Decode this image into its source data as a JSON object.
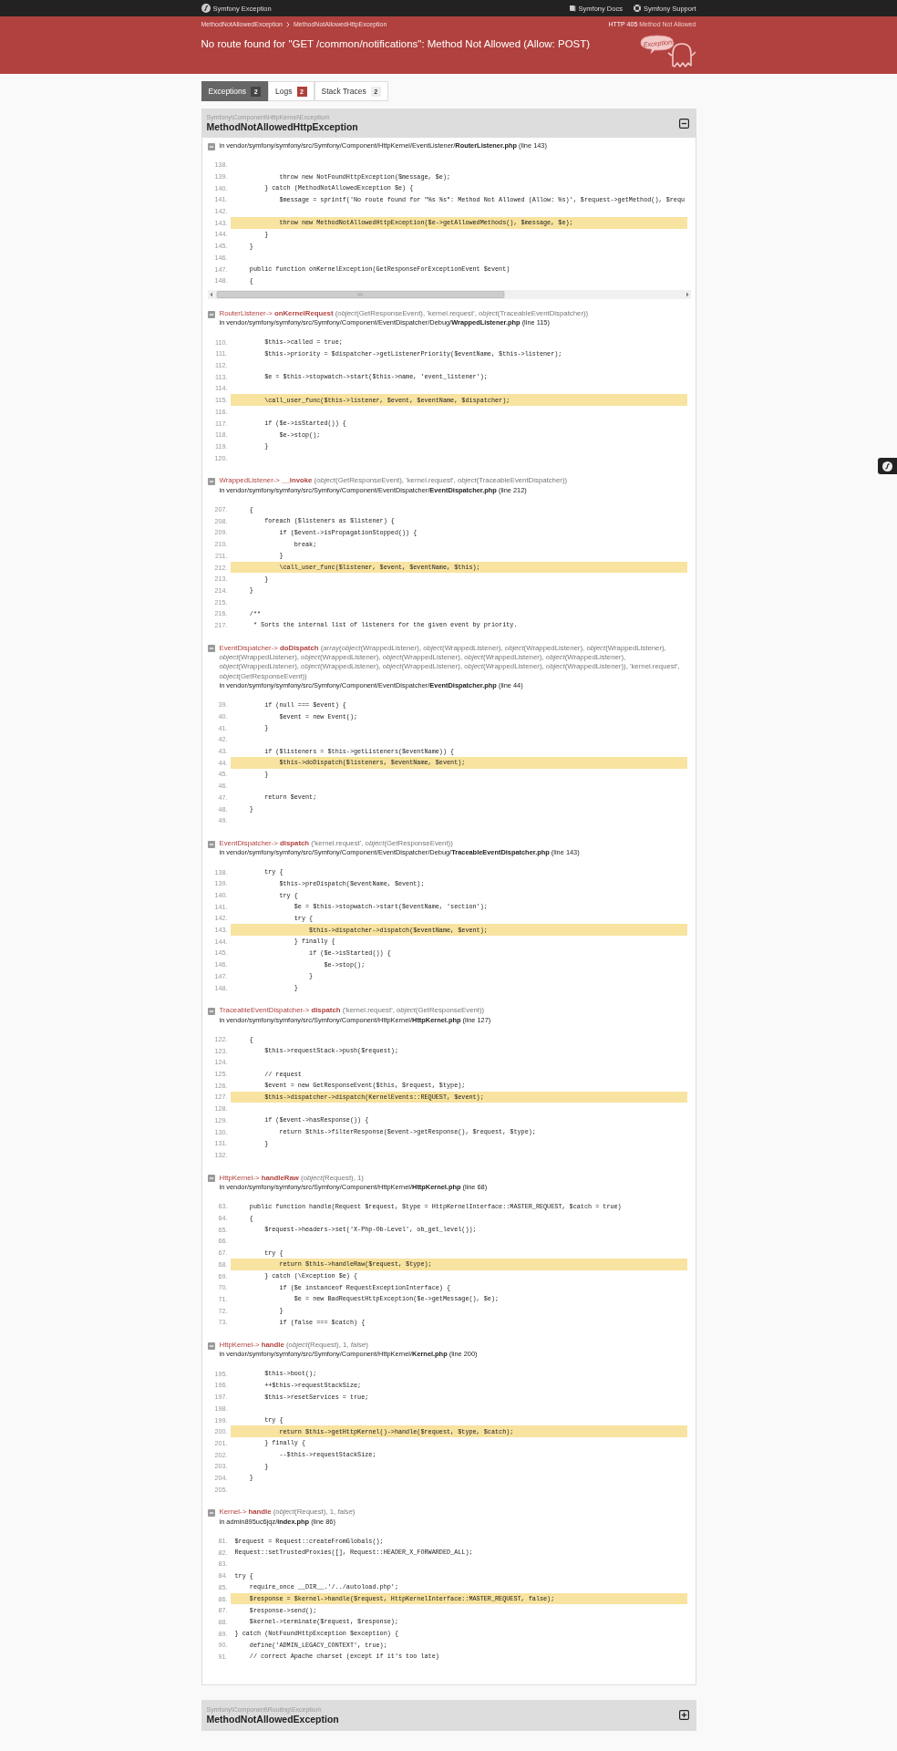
{
  "top_bar": {
    "brand": "Symfony Exception",
    "links": [
      "Symfony Docs",
      "Symfony Support"
    ]
  },
  "header": {
    "breadcrumbs": [
      "MethodNotAllowedException",
      "MethodNotAllowedHttpException"
    ],
    "status_code": "HTTP 405",
    "status_text": "Method Not Allowed",
    "message": "No route found for \"GET /common/notifications\": Method Not Allowed (Allow: POST)",
    "bubble": "Exception!"
  },
  "tabs": [
    {
      "label": "Exceptions",
      "count": "2",
      "color": "#444444",
      "selected": true
    },
    {
      "label": "Logs",
      "count": "2",
      "color": "#b0413e",
      "selected": false
    },
    {
      "label": "Stack Traces",
      "count": "2",
      "color": "#eeeeee",
      "selected": false
    }
  ],
  "exceptions": [
    {
      "namespace": "Symfony\\Component\\HttpKernel\\Exception\\",
      "class": "MethodNotAllowedHttpException",
      "expanded": true,
      "traces": [
        {
          "expanded": true,
          "location": "in vendor/symfony/symfony/src/Symfony/Component/HttpKernel/EventListener/**RouterListener.php** (line 143)",
          "lines": [
            {
              "number": "138.",
              "highlighted": false
            },
            {
              "number": "139.",
              "code": "            throw new NotFoundHttpException($message, $e);",
              "highlighted": false
            },
            {
              "number": "140.",
              "code": "        } catch (MethodNotAllowedException $e) {",
              "highlighted": false
            },
            {
              "number": "141.",
              "code": "            $message = sprintf('No route found for \"%s %s\": Method Not Allowed (Allow: %s)', $request->getMethod(), $requ",
              "highlighted": false
            },
            {
              "number": "142.",
              "highlighted": false
            },
            {
              "number": "143.",
              "code": "            throw new MethodNotAllowedHttpException($e->getAllowedMethods(), $message, $e);",
              "highlighted": true
            },
            {
              "number": "144.",
              "code": "        }",
              "highlighted": false
            },
            {
              "number": "145.",
              "code": "    }",
              "highlighted": false
            },
            {
              "number": "146.",
              "highlighted": false
            },
            {
              "number": "147.",
              "code": "    public function onKernelException(GetResponseForExceptionEvent $event)",
              "highlighted": false
            },
            {
              "number": "148.",
              "code": "    {",
              "highlighted": false
            }
          ]
        },
        {
          "expanded": true,
          "caller": "RouterListener->",
          "method": "onKernelRequest",
          "args": "(*object*(GetResponseEvent), 'kernel.request', *object*(TraceableEventDispatcher))",
          "location": "in vendor/symfony/symfony/src/Symfony/Component/EventDispatcher/Debug/**WrappedListener.php** (line 115)",
          "lines": [
            {
              "number": "110.",
              "code": "        $this->called = true;",
              "highlighted": false
            },
            {
              "number": "111.",
              "code": "        $this->priority = $dispatcher->getListenerPriority($eventName, $this->listener);",
              "highlighted": false
            },
            {
              "number": "112.",
              "highlighted": false
            },
            {
              "number": "113.",
              "code": "        $e = $this->stopwatch->start($this->name, 'event_listener');",
              "highlighted": false
            },
            {
              "number": "114.",
              "highlighted": false
            },
            {
              "number": "115.",
              "code": "        \\call_user_func($this->listener, $event, $eventName, $dispatcher);",
              "highlighted": true
            },
            {
              "number": "116.",
              "highlighted": false
            },
            {
              "number": "117.",
              "code": "        if ($e->isStarted()) {",
              "highlighted": false
            },
            {
              "number": "118.",
              "code": "            $e->stop();",
              "highlighted": false
            },
            {
              "number": "119.",
              "code": "        }",
              "highlighted": false
            },
            {
              "number": "120.",
              "highlighted": false
            }
          ]
        },
        {
          "expanded": true,
          "caller": "WrappedListener->",
          "method": "__invoke",
          "args": "(*object*(GetResponseEvent), 'kernel.request', *object*(TraceableEventDispatcher))",
          "location": "in vendor/symfony/symfony/src/Symfony/Component/EventDispatcher/**EventDispatcher.php** (line 212)",
          "lines": [
            {
              "number": "207.",
              "code": "    {",
              "highlighted": false
            },
            {
              "number": "208.",
              "code": "        foreach ($listeners as $listener) {",
              "highlighted": false
            },
            {
              "number": "209.",
              "code": "            if ($event->isPropagationStopped()) {",
              "highlighted": false
            },
            {
              "number": "210.",
              "code": "                break;",
              "highlighted": false
            },
            {
              "number": "211.",
              "code": "            }",
              "highlighted": false
            },
            {
              "number": "212.",
              "code": "            \\call_user_func($listener, $event, $eventName, $this);",
              "highlighted": true
            },
            {
              "number": "213.",
              "code": "        }",
              "highlighted": false
            },
            {
              "number": "214.",
              "code": "    }",
              "highlighted": false
            },
            {
              "number": "215.",
              "highlighted": false
            },
            {
              "number": "216.",
              "code": "    /**",
              "highlighted": false
            },
            {
              "number": "217.",
              "code": "     * Sorts the internal list of listeners for the given event by priority.",
              "highlighted": false
            }
          ]
        },
        {
          "expanded": true,
          "caller": "EventDispatcher->",
          "method": "doDispatch",
          "args": "(*array*(*object*(WrappedListener), *object*(WrappedListener), *object*(WrappedListener), *object*(WrappedListener), *object*(WrappedListener), *object*(WrappedListener), *object*(WrappedListener), *object*(WrappedListener), *object*(WrappedListener), *object*(WrappedListener), *object*(WrappedListener), *object*(WrappedListener), *object*(WrappedListener), *object*(WrappedListener)), 'kernel.request', *object*(GetResponseEvent))",
          "location": "in vendor/symfony/symfony/src/Symfony/Component/EventDispatcher/**EventDispatcher.php** (line 44)",
          "lines": [
            {
              "number": "39.",
              "code": "        if (null === $event) {",
              "highlighted": false
            },
            {
              "number": "40.",
              "code": "            $event = new Event();",
              "highlighted": false
            },
            {
              "number": "41.",
              "code": "        }",
              "highlighted": false
            },
            {
              "number": "42.",
              "highlighted": false
            },
            {
              "number": "43.",
              "code": "        if ($listeners = $this->getListeners($eventName)) {",
              "highlighted": false
            },
            {
              "number": "44.",
              "code": "            $this->doDispatch($listeners, $eventName, $event);",
              "highlighted": true
            },
            {
              "number": "45.",
              "code": "        }",
              "highlighted": false
            },
            {
              "number": "46.",
              "highlighted": false
            },
            {
              "number": "47.",
              "code": "        return $event;",
              "highlighted": false
            },
            {
              "number": "48.",
              "code": "    }",
              "highlighted": false
            },
            {
              "number": "49.",
              "highlighted": false
            }
          ]
        },
        {
          "expanded": true,
          "caller": "EventDispatcher->",
          "method": "dispatch",
          "args": "('kernel.request', *object*(GetResponseEvent))",
          "location": "in vendor/symfony/symfony/src/Symfony/Component/EventDispatcher/Debug/**TraceableEventDispatcher.php** (line 143)",
          "lines": [
            {
              "number": "138.",
              "code": "        try {",
              "highlighted": false
            },
            {
              "number": "139.",
              "code": "            $this->preDispatch($eventName, $event);",
              "highlighted": false
            },
            {
              "number": "140.",
              "code": "            try {",
              "highlighted": false
            },
            {
              "number": "141.",
              "code": "                $e = $this->stopwatch->start($eventName, 'section');",
              "highlighted": false
            },
            {
              "number": "142.",
              "code": "                try {",
              "highlighted": false
            },
            {
              "number": "143.",
              "code": "                    $this->dispatcher->dispatch($eventName, $event);",
              "highlighted": true
            },
            {
              "number": "144.",
              "code": "                } finally {",
              "highlighted": false
            },
            {
              "number": "145.",
              "code": "                    if ($e->isStarted()) {",
              "highlighted": false
            },
            {
              "number": "146.",
              "code": "                        $e->stop();",
              "highlighted": false
            },
            {
              "number": "147.",
              "code": "                    }",
              "highlighted": false
            },
            {
              "number": "148.",
              "code": "                }",
              "highlighted": false
            }
          ]
        },
        {
          "expanded": true,
          "caller": "TraceableEventDispatcher->",
          "method": "dispatch",
          "args": "('kernel.request', *object*(GetResponseEvent))",
          "location": "in vendor/symfony/symfony/src/Symfony/Component/HttpKernel/**HttpKernel.php** (line 127)",
          "lines": [
            {
              "number": "122.",
              "code": "    {",
              "highlighted": false
            },
            {
              "number": "123.",
              "code": "        $this->requestStack->push($request);",
              "highlighted": false
            },
            {
              "number": "124.",
              "highlighted": false
            },
            {
              "number": "125.",
              "code": "        // request",
              "highlighted": false
            },
            {
              "number": "126.",
              "code": "        $event = new GetResponseEvent($this, $request, $type);",
              "highlighted": false
            },
            {
              "number": "127.",
              "code": "        $this->dispatcher->dispatch(KernelEvents::REQUEST, $event);",
              "highlighted": true
            },
            {
              "number": "128.",
              "highlighted": false
            },
            {
              "number": "129.",
              "code": "        if ($event->hasResponse()) {",
              "highlighted": false
            },
            {
              "number": "130.",
              "code": "            return $this->filterResponse($event->getResponse(), $request, $type);",
              "highlighted": false
            },
            {
              "number": "131.",
              "code": "        }",
              "highlighted": false
            },
            {
              "number": "132.",
              "highlighted": false
            }
          ]
        },
        {
          "expanded": true,
          "caller": "HttpKernel->",
          "method": "handleRaw",
          "args": "(*object*(Request), 1)",
          "location": "in vendor/symfony/symfony/src/Symfony/Component/HttpKernel/**HttpKernel.php** (line 68)",
          "lines": [
            {
              "number": "63.",
              "code": "    public function handle(Request $request, $type = HttpKernelInterface::MASTER_REQUEST, $catch = true)",
              "highlighted": false
            },
            {
              "number": "64.",
              "code": "    {",
              "highlighted": false
            },
            {
              "number": "65.",
              "code": "        $request->headers->set('X-Php-Ob-Level', ob_get_level());",
              "highlighted": false
            },
            {
              "number": "66.",
              "highlighted": false
            },
            {
              "number": "67.",
              "code": "        try {",
              "highlighted": false
            },
            {
              "number": "68.",
              "code": "            return $this->handleRaw($request, $type);",
              "highlighted": true
            },
            {
              "number": "69.",
              "code": "        } catch (\\Exception $e) {",
              "highlighted": false
            },
            {
              "number": "70.",
              "code": "            if ($e instanceof RequestExceptionInterface) {",
              "highlighted": false
            },
            {
              "number": "71.",
              "code": "                $e = new BadRequestHttpException($e->getMessage(), $e);",
              "highlighted": false
            },
            {
              "number": "72.",
              "code": "            }",
              "highlighted": false
            },
            {
              "number": "73.",
              "code": "            if (false === $catch) {",
              "highlighted": false
            }
          ]
        },
        {
          "expanded": true,
          "caller": "HttpKernel->",
          "method": "handle",
          "args": "(*object*(Request), 1, *false*)",
          "location": "in vendor/symfony/symfony/src/Symfony/Component/HttpKernel/**Kernel.php** (line 200)",
          "lines": [
            {
              "number": "195.",
              "code": "        $this->boot();",
              "highlighted": false
            },
            {
              "number": "196.",
              "code": "        ++$this->requestStackSize;",
              "highlighted": false
            },
            {
              "number": "197.",
              "code": "        $this->resetServices = true;",
              "highlighted": false
            },
            {
              "number": "198.",
              "highlighted": false
            },
            {
              "number": "199.",
              "code": "        try {",
              "highlighted": false
            },
            {
              "number": "200.",
              "code": "            return $this->getHttpKernel()->handle($request, $type, $catch);",
              "highlighted": true
            },
            {
              "number": "201.",
              "code": "        } finally {",
              "highlighted": false
            },
            {
              "number": "202.",
              "code": "            --$this->requestStackSize;",
              "highlighted": false
            },
            {
              "number": "203.",
              "code": "        }",
              "highlighted": false
            },
            {
              "number": "204.",
              "code": "    }",
              "highlighted": false
            },
            {
              "number": "205.",
              "highlighted": false
            }
          ]
        },
        {
          "expanded": true,
          "caller": "Kernel->",
          "method": "handle",
          "args": "(*object*(Request), 1, *false*)",
          "location": "in admin895uc6jqz/**index.php** (line 86)",
          "lines": [
            {
              "number": "81.",
              "code": "$request = Request::createFromGlobals();",
              "highlighted": false
            },
            {
              "number": "82.",
              "code": "Request::setTrustedProxies([], Request::HEADER_X_FORWARDED_ALL);",
              "highlighted": false
            },
            {
              "number": "83.",
              "highlighted": false
            },
            {
              "number": "84.",
              "code": "try {",
              "highlighted": false
            },
            {
              "number": "85.",
              "code": "    require_once __DIR__.'/../autoload.php';",
              "highlighted": false
            },
            {
              "number": "86.",
              "code": "    $response = $kernel->handle($request, HttpKernelInterface::MASTER_REQUEST, false);",
              "highlighted": true
            },
            {
              "number": "87.",
              "code": "    $response->send();",
              "highlighted": false
            },
            {
              "number": "88.",
              "code": "    $kernel->terminate($request, $response);",
              "highlighted": false
            },
            {
              "number": "89.",
              "code": "} catch (NotFoundHttpException $exception) {",
              "highlighted": false
            },
            {
              "number": "90.",
              "code": "    define('ADMIN_LEGACY_CONTEXT', true);",
              "highlighted": false
            },
            {
              "number": "91.",
              "code": "    // correct Apache charset (except if it's too late)",
              "highlighted": false
            }
          ]
        }
      ]
    },
    {
      "namespace": "Symfony\\Component\\Routing\\Exception\\",
      "class": "MethodNotAllowedException",
      "expanded": false
    }
  ]
}
